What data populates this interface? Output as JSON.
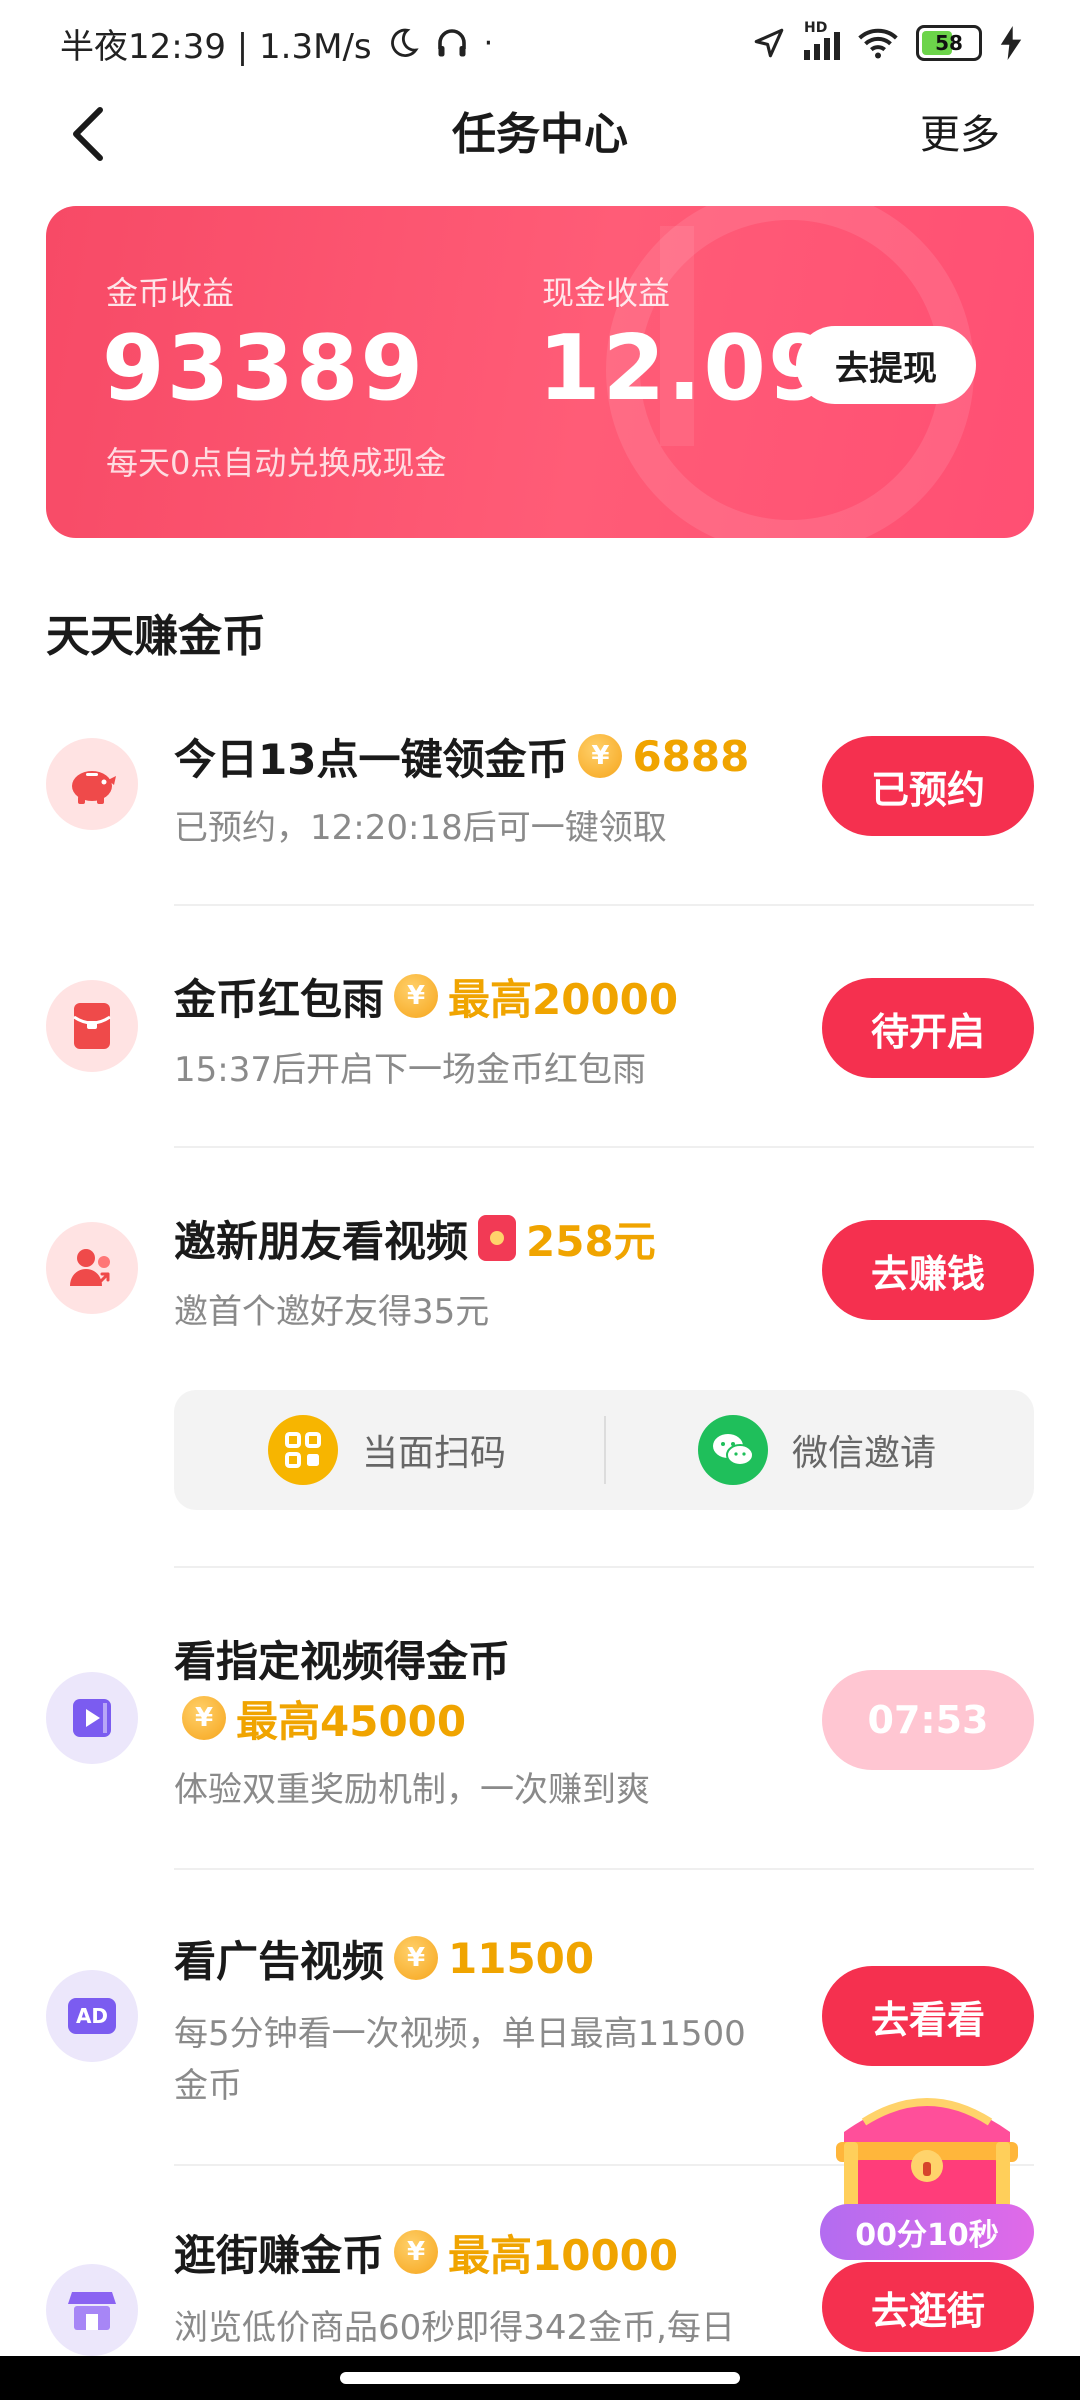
{
  "status_bar": {
    "time_label": "半夜12:39 | 1.3M/s",
    "battery": "58",
    "network": "HD"
  },
  "nav": {
    "title": "任务中心",
    "more": "更多"
  },
  "earnings": {
    "coin_label": "金币收益",
    "coin_value": "93389",
    "coin_note": "每天0点自动兑换成现金",
    "cash_label": "现金收益",
    "cash_value": "12.09",
    "withdraw_label": "去提现"
  },
  "section_title": "天天赚金币",
  "tasks": [
    {
      "title": "今日13点一键领金币",
      "reward": "6888",
      "subtitle": "已预约，12:20:18后可一键领取",
      "button": "已预约",
      "icon": "piggy-bank-icon"
    },
    {
      "title": "金币红包雨",
      "reward": "最高20000",
      "subtitle": "15:37后开启下一场金币红包雨",
      "button": "待开启",
      "icon": "red-packet-icon"
    },
    {
      "title": "邀新朋友看视频",
      "reward": "258元",
      "subtitle": "邀首个邀好友得35元",
      "button": "去赚钱",
      "icon": "invite-friends-icon"
    },
    {
      "title": "看指定视频得金币",
      "reward": "最高45000",
      "subtitle": "体验双重奖励机制，一次赚到爽",
      "button": "07:53",
      "icon": "video-icon"
    },
    {
      "title": "看广告视频",
      "reward": "11500",
      "subtitle_line1": "每5分钟看一次视频，单日最高11500",
      "subtitle_line2": "金币",
      "button": "去看看",
      "icon": "ad-icon",
      "icon_text": "AD"
    },
    {
      "title": "逛街赚金币",
      "reward": "最高10000",
      "subtitle": "浏览低价商品60秒即得342金币,每日",
      "button": "去逛街",
      "icon": "shop-icon"
    }
  ],
  "invite": {
    "scan_label": "当面扫码",
    "wechat_label": "微信邀请"
  },
  "floating": {
    "timer": "00分10秒"
  },
  "colors": {
    "accent": "#f5304f",
    "reward": "#f0a400",
    "card_gradient_start": "#f74a66",
    "card_gradient_end": "#ff4f73"
  }
}
